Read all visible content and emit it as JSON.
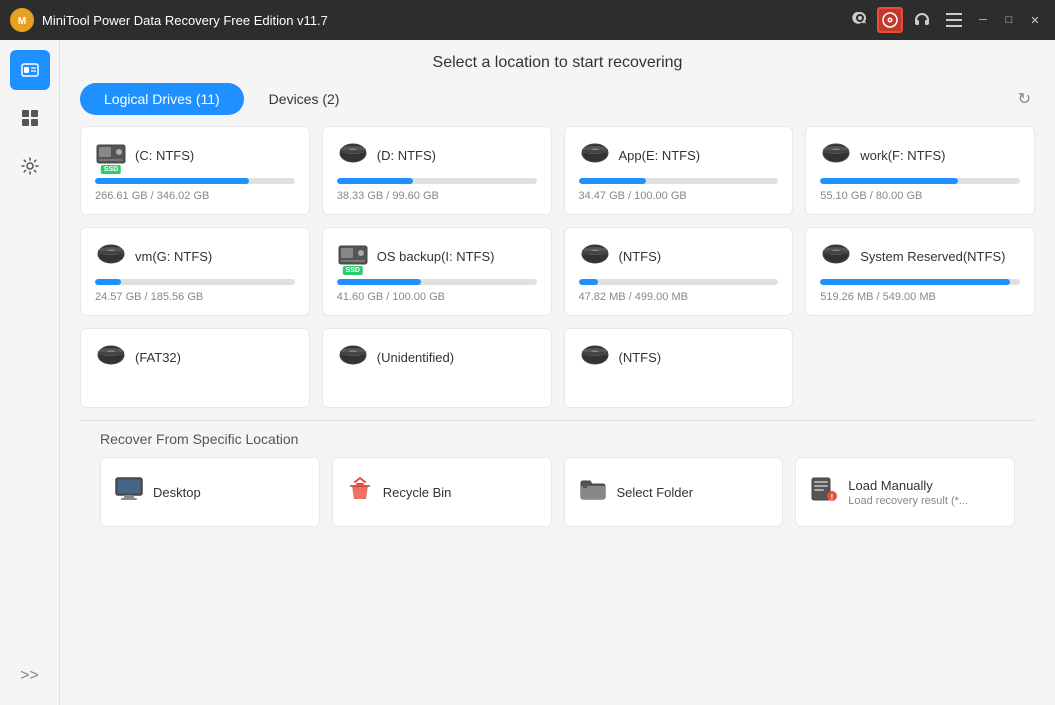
{
  "titleBar": {
    "title": "MiniTool Power Data Recovery Free Edition v11.7",
    "logoText": "M",
    "icons": {
      "key": "🔑",
      "disc": "💿",
      "headphones": "🎧",
      "menu": "≡",
      "minimize": "─",
      "maximize": "□",
      "close": "✕"
    }
  },
  "header": {
    "title": "Select a location to start recovering"
  },
  "tabs": [
    {
      "id": "logical",
      "label": "Logical Drives (11)",
      "active": true
    },
    {
      "id": "devices",
      "label": "Devices (2)",
      "active": false
    }
  ],
  "refresh": "↻",
  "drives": [
    {
      "name": "(C: NTFS)",
      "used": 266.61,
      "total": 346.02,
      "usedLabel": "266.61 GB",
      "totalLabel": "346.02 GB",
      "pct": 77,
      "ssd": true
    },
    {
      "name": "(D: NTFS)",
      "used": 38.33,
      "total": 99.6,
      "usedLabel": "38.33 GB",
      "totalLabel": "99.60 GB",
      "pct": 38,
      "ssd": false
    },
    {
      "name": "App(E: NTFS)",
      "used": 34.47,
      "total": 100.0,
      "usedLabel": "34.47 GB",
      "totalLabel": "100.00 GB",
      "pct": 34,
      "ssd": false
    },
    {
      "name": "work(F: NTFS)",
      "used": 55.1,
      "total": 80.0,
      "usedLabel": "55.10 GB",
      "totalLabel": "80.00 GB",
      "pct": 69,
      "ssd": false
    },
    {
      "name": "vm(G: NTFS)",
      "used": 24.57,
      "total": 185.56,
      "usedLabel": "24.57 GB",
      "totalLabel": "185.56 GB",
      "pct": 13,
      "ssd": false
    },
    {
      "name": "OS backup(I: NTFS)",
      "used": 41.6,
      "total": 100.0,
      "usedLabel": "41.60 GB",
      "totalLabel": "100.00 GB",
      "pct": 42,
      "ssd": true
    },
    {
      "name": "(NTFS)",
      "used": 47.82,
      "total": 499.0,
      "usedLabel": "47.82 MB",
      "totalLabel": "499.00 MB",
      "pct": 10,
      "ssd": false
    },
    {
      "name": "System Reserved(NTFS)",
      "used": 519.26,
      "total": 549.0,
      "usedLabel": "519.26 MB",
      "totalLabel": "549.00 MB",
      "pct": 95,
      "ssd": false
    },
    {
      "name": "(FAT32)",
      "empty": true
    },
    {
      "name": "(Unidentified)",
      "empty": true
    },
    {
      "name": "(NTFS)",
      "empty": true
    }
  ],
  "recoverSection": {
    "title": "Recover From Specific Location",
    "items": [
      {
        "id": "desktop",
        "name": "Desktop",
        "sub": "",
        "icon": "desktop"
      },
      {
        "id": "recycle",
        "name": "Recycle Bin",
        "sub": "",
        "icon": "recycle"
      },
      {
        "id": "folder",
        "name": "Select Folder",
        "sub": "",
        "icon": "folder"
      },
      {
        "id": "manual",
        "name": "Load Manually",
        "sub": "Load recovery result (*...",
        "icon": "manual"
      }
    ]
  },
  "sidebar": {
    "items": [
      {
        "id": "recovery",
        "label": "Data Recovery",
        "active": true
      },
      {
        "id": "tools",
        "label": "Tools",
        "active": false
      },
      {
        "id": "settings",
        "label": "Settings",
        "active": false
      }
    ],
    "expand": ">>"
  }
}
